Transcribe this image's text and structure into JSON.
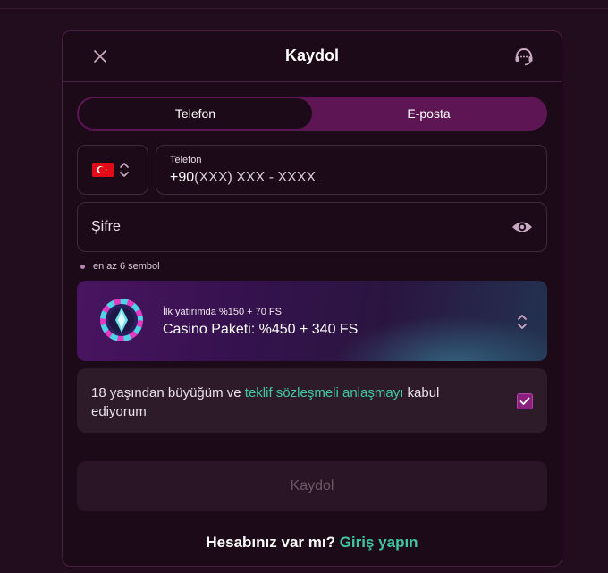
{
  "modal": {
    "title": "Kaydol",
    "close_icon": "close-icon",
    "support_icon": "headset-icon"
  },
  "tabs": [
    {
      "label": "Telefon",
      "active": true
    },
    {
      "label": "E-posta",
      "active": false
    }
  ],
  "phone": {
    "country_flag": "turkey-flag-icon",
    "label": "Telefon",
    "prefix": "+90",
    "placeholder": "(XXX) XXX - XXXX"
  },
  "password": {
    "placeholder": "Şifre",
    "hint": "en az 6 sembol",
    "toggle_icon": "eye-icon"
  },
  "bonus": {
    "subtitle": "İlk yatırımda %150 + 70 FS",
    "title": "Casino Paketi: %450 + 340 FS",
    "icon": "casino-chip-icon"
  },
  "terms": {
    "text_before": "18 yaşından büyüğüm ve ",
    "link": "teklif sözleşmeli anlaşmayı",
    "text_after": " kabul ediyorum",
    "checked": true
  },
  "submit_label": "Kaydol",
  "login": {
    "question": "Hesabınız var mı?",
    "link": "Giriş yapın"
  },
  "colors": {
    "background": "#210d1d",
    "accent_tab": "#5e1554",
    "link_green": "#42c7a5",
    "checkbox": "#8b1f7f"
  }
}
